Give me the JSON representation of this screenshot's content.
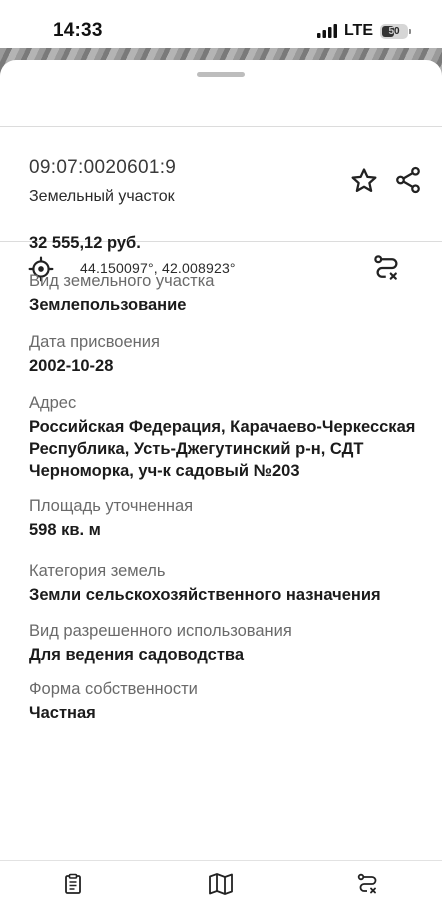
{
  "status_bar": {
    "time": "14:33",
    "network": "LTE",
    "battery": "50"
  },
  "parcel": {
    "cadastral_number": "09:07:0020601:9",
    "object_type": "Земельный участок",
    "coordinates": "44.150097°, 42.008923°"
  },
  "fields": [
    {
      "label": "",
      "value": "32 555,12 руб."
    },
    {
      "label": "Вид земельного участка",
      "value": "Землепользование"
    },
    {
      "label": "Дата присвоения",
      "value": "2002-10-28"
    },
    {
      "label": "Адрес",
      "value": "Российская Федерация, Карачаево-Черкесская Республика, Усть-Джегутинский р-н, СДТ Черноморка, уч-к садовый №203"
    },
    {
      "label": "Площадь уточненная",
      "value": "598 кв. м"
    },
    {
      "label": "Категория земель",
      "value": "Земли сельскохозяйственного назначения"
    },
    {
      "label": "Вид разрешенного использования",
      "value": "Для ведения садоводства"
    },
    {
      "label": "Форма собственности",
      "value": "Частная"
    }
  ],
  "icons": {
    "favorite": "star-icon",
    "share": "share-icon",
    "locate": "crosshair-icon",
    "route": "route-icon",
    "nav_info": "clipboard-icon",
    "nav_map": "map-icon",
    "nav_route": "route-icon"
  }
}
